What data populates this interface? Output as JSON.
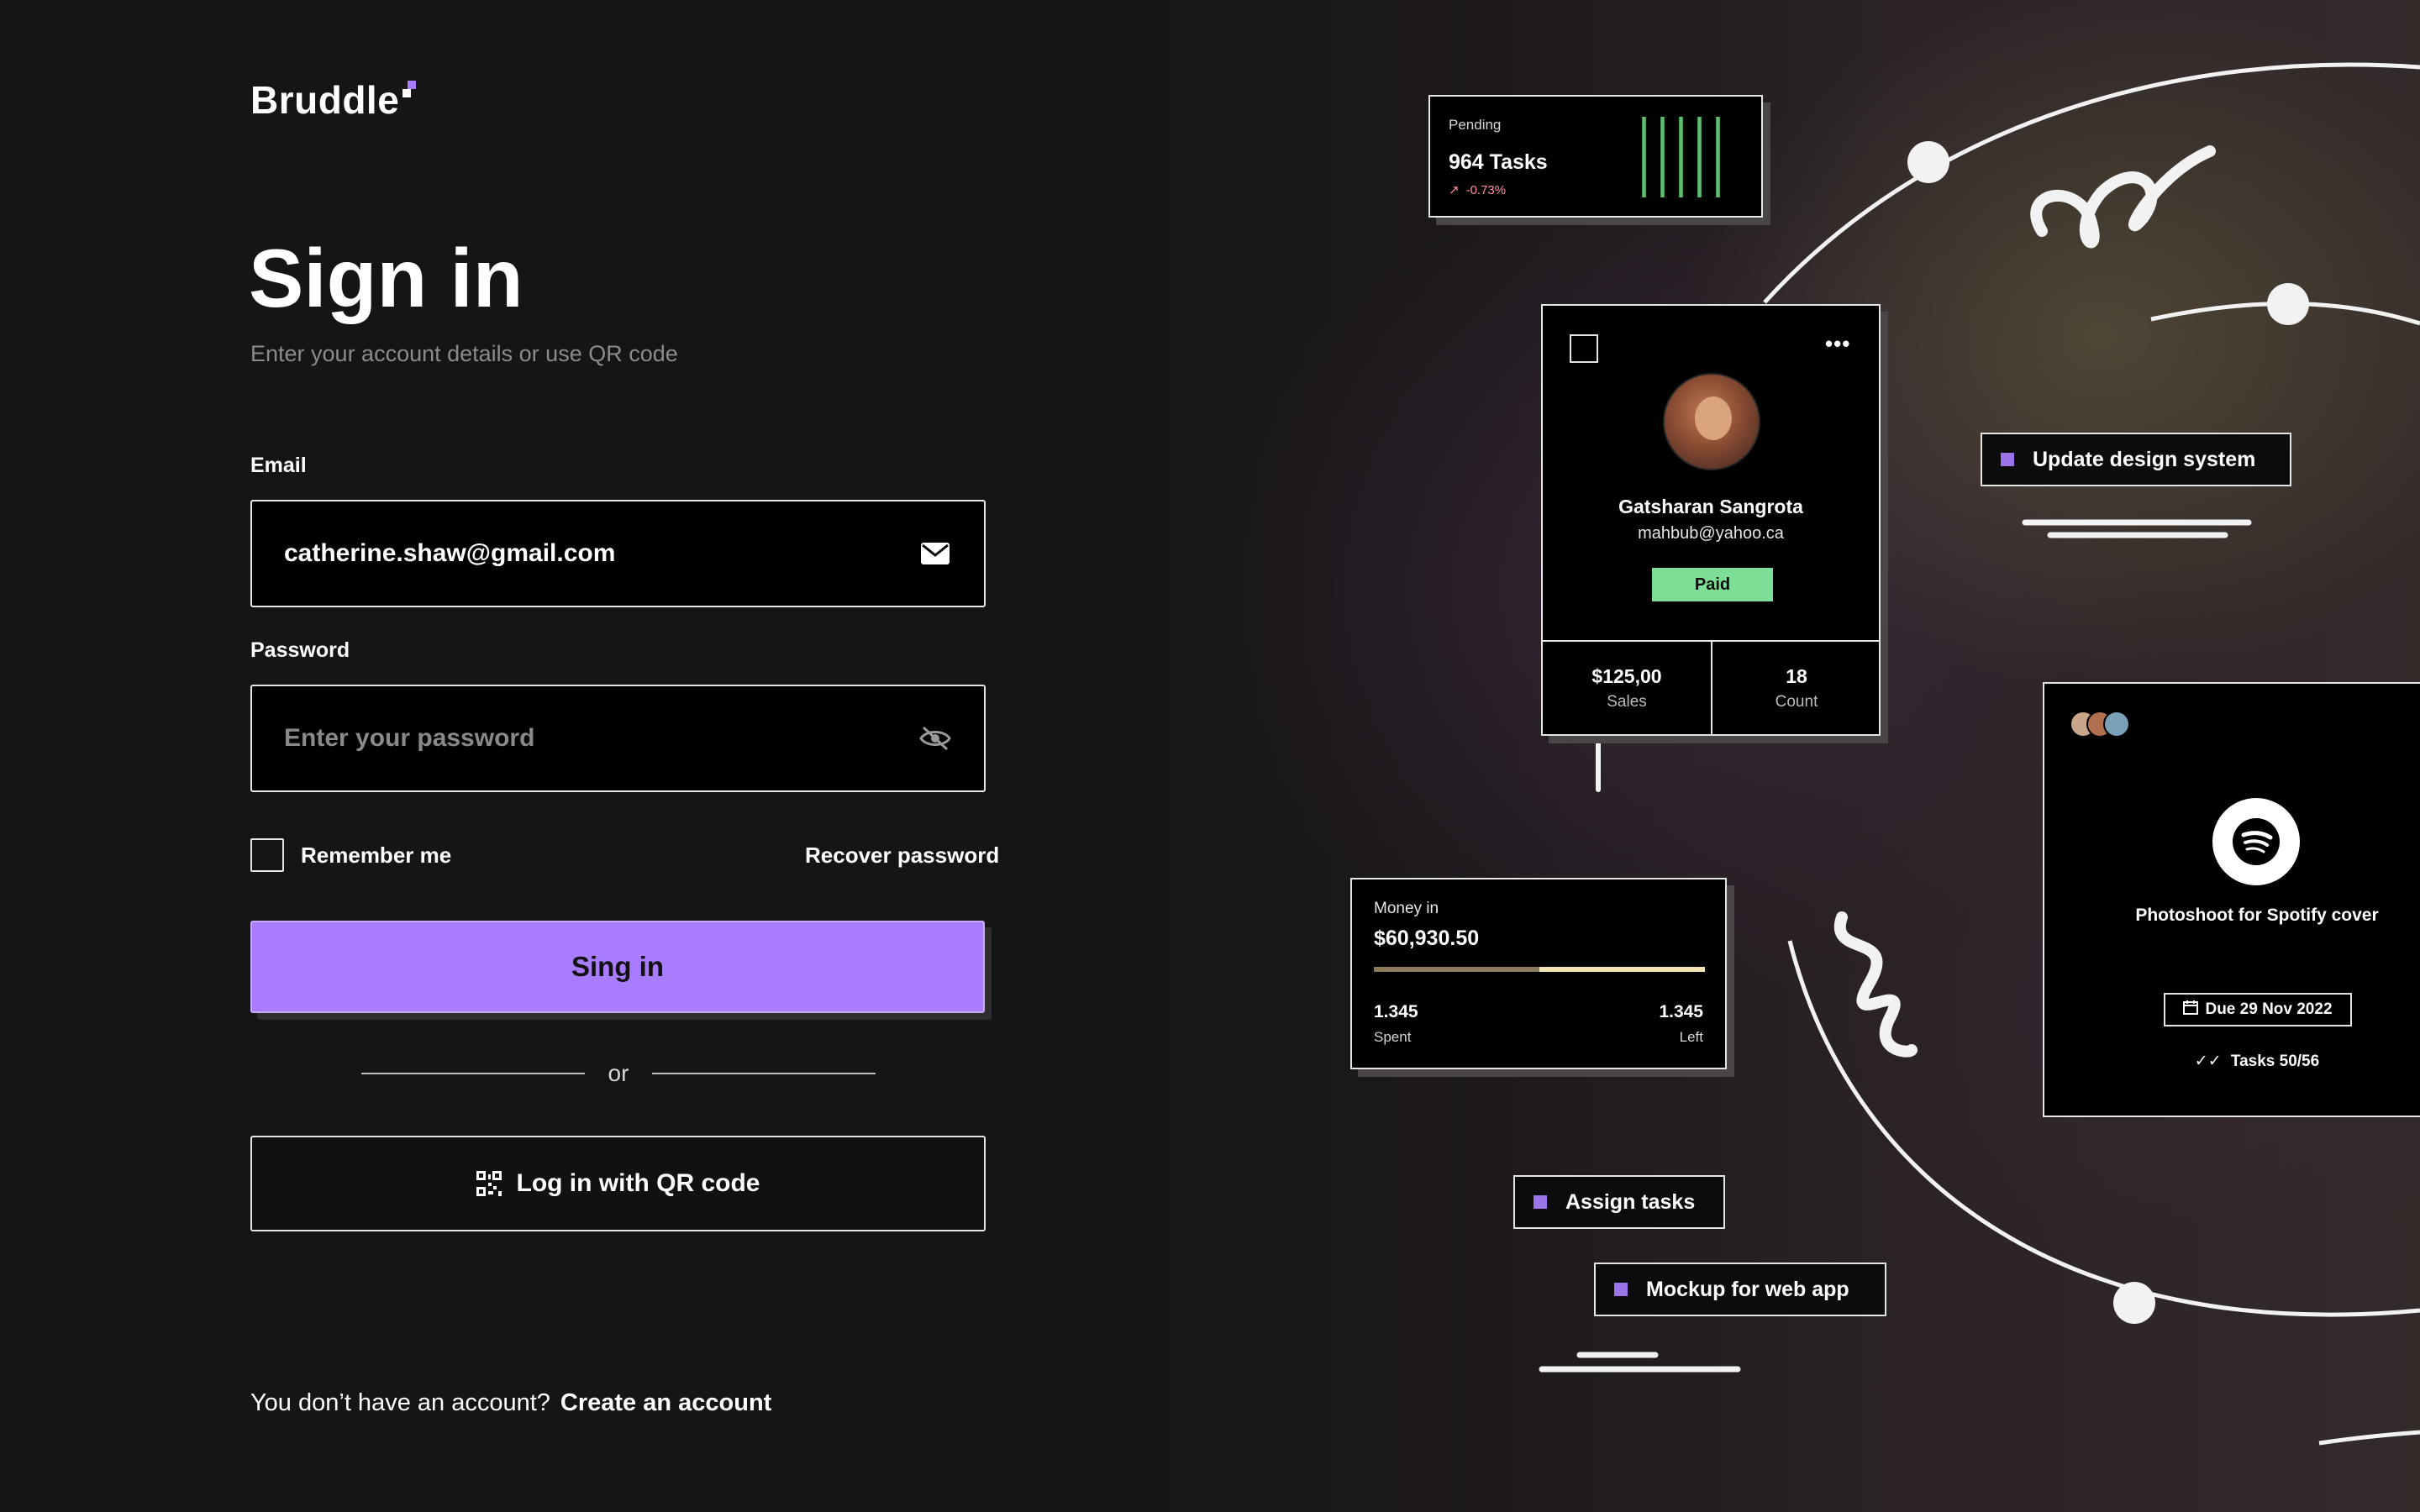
{
  "brand": {
    "name": "Bruddle",
    "accent": "#a97cff"
  },
  "form": {
    "title": "Sign in",
    "subtitle": "Enter your account details or use QR code",
    "email": {
      "label": "Email",
      "value": "catherine.shaw@gmail.com",
      "icon": "mail-icon"
    },
    "password": {
      "label": "Password",
      "placeholder": "Enter your password",
      "icon": "eye-off-icon"
    },
    "remember_label": "Remember me",
    "recover_label": "Recover password",
    "submit_label": "Sing in",
    "divider_label": "or",
    "qr_label": "Log in with QR code",
    "footer_text": "You don’t have an account?",
    "footer_link": "Create an account"
  },
  "illustration": {
    "pending": {
      "label": "Pending",
      "value": "964 Tasks",
      "change": "-0.73%"
    },
    "profile": {
      "name": "Gatsharan Sangrota",
      "email": "mahbub@yahoo.ca",
      "status": "Paid",
      "sales_value": "$125,00",
      "sales_label": "Sales",
      "count_value": "18",
      "count_label": "Count",
      "menu_icon": "more-horizontal-icon"
    },
    "money": {
      "label": "Money in",
      "value": "$60,930.50",
      "spent_value": "1.345",
      "spent_label": "Spent",
      "left_value": "1.345",
      "left_label": "Left",
      "progress": 0.5
    },
    "task_card": {
      "title": "Photoshoot for Spotify cover",
      "due": "Due 29 Nov 2022",
      "tasks": "Tasks 50/56",
      "icon": "spotify-icon"
    },
    "tags": {
      "update": "Update design system",
      "assign": "Assign tasks",
      "mockup": "Mockup for web app"
    }
  }
}
